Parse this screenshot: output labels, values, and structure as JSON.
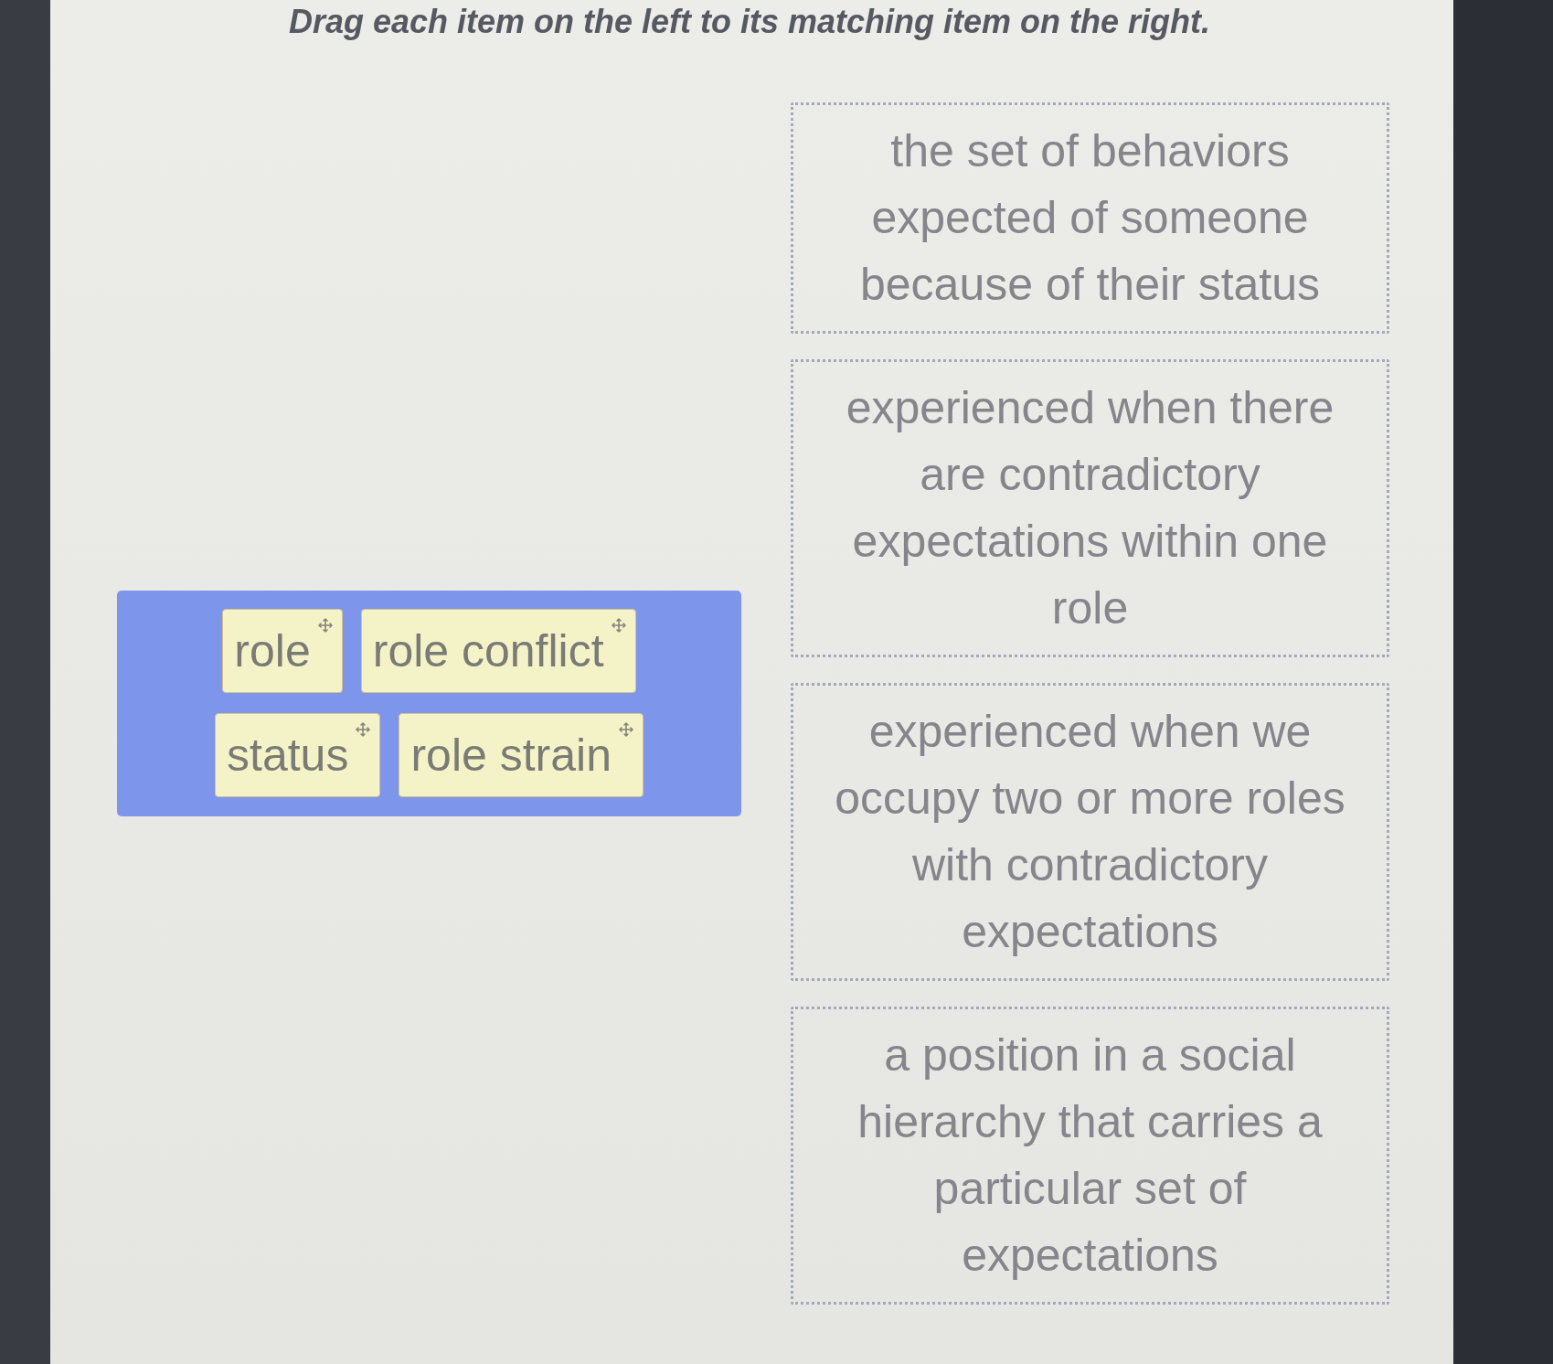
{
  "instruction": "Drag each item on the left to its matching item on the right.",
  "choices": [
    "role",
    "role conflict",
    "status",
    "role strain"
  ],
  "targets": [
    "the set of behaviors expected of someone because of their status",
    "experienced when there are contradictory expectations within one role",
    "experienced when we occupy two or more roles with contradictory expectations",
    "a position in a social hierarchy that carries a particular set of expectations"
  ]
}
